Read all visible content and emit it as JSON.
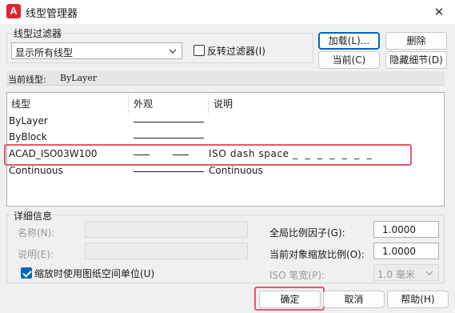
{
  "window": {
    "title": "线型管理器",
    "app_icon_letter": "A",
    "close": "✕"
  },
  "filter": {
    "group_label": "线型过滤器",
    "select_value": "显示所有线型",
    "invert_label": "反转过滤器(I)",
    "invert_checked": false
  },
  "buttons": {
    "load": "加载(L)...",
    "delete": "删除",
    "current": "当前(C)",
    "hide_details": "隐藏细节(D)",
    "ok": "确定",
    "cancel": "取消",
    "help": "帮助(H)"
  },
  "current_linetype": {
    "label": "当前线型:",
    "value": "ByLayer"
  },
  "list": {
    "columns": [
      "线型",
      "外观",
      "说明"
    ],
    "rows": [
      {
        "name": "ByLayer",
        "appearance": "solid",
        "description": ""
      },
      {
        "name": "ByBlock",
        "appearance": "solid",
        "description": ""
      },
      {
        "name": "ACAD_ISO03W100",
        "appearance": "dash",
        "description": "ISO dash space _  _  _  _  _  _  _"
      },
      {
        "name": "Continuous",
        "appearance": "solid",
        "description": "Continuous"
      }
    ]
  },
  "details": {
    "group_label": "详细信息",
    "name_label": "名称(N):",
    "desc_label": "说明(E):",
    "paper_units_label": "缩放时使用图纸空间单位(U)",
    "paper_units_checked": true,
    "global_scale_label": "全局比例因子(G):",
    "global_scale_value": "1.0000",
    "object_scale_label": "当前对象缩放比例(O):",
    "object_scale_value": "1.0000",
    "iso_pen_label": "ISO 笔宽(P):",
    "iso_pen_value": "1.0 毫米"
  },
  "colors": {
    "accent": "#0067c0",
    "highlight": "#e05a6a",
    "app_icon": "#e0242e"
  }
}
